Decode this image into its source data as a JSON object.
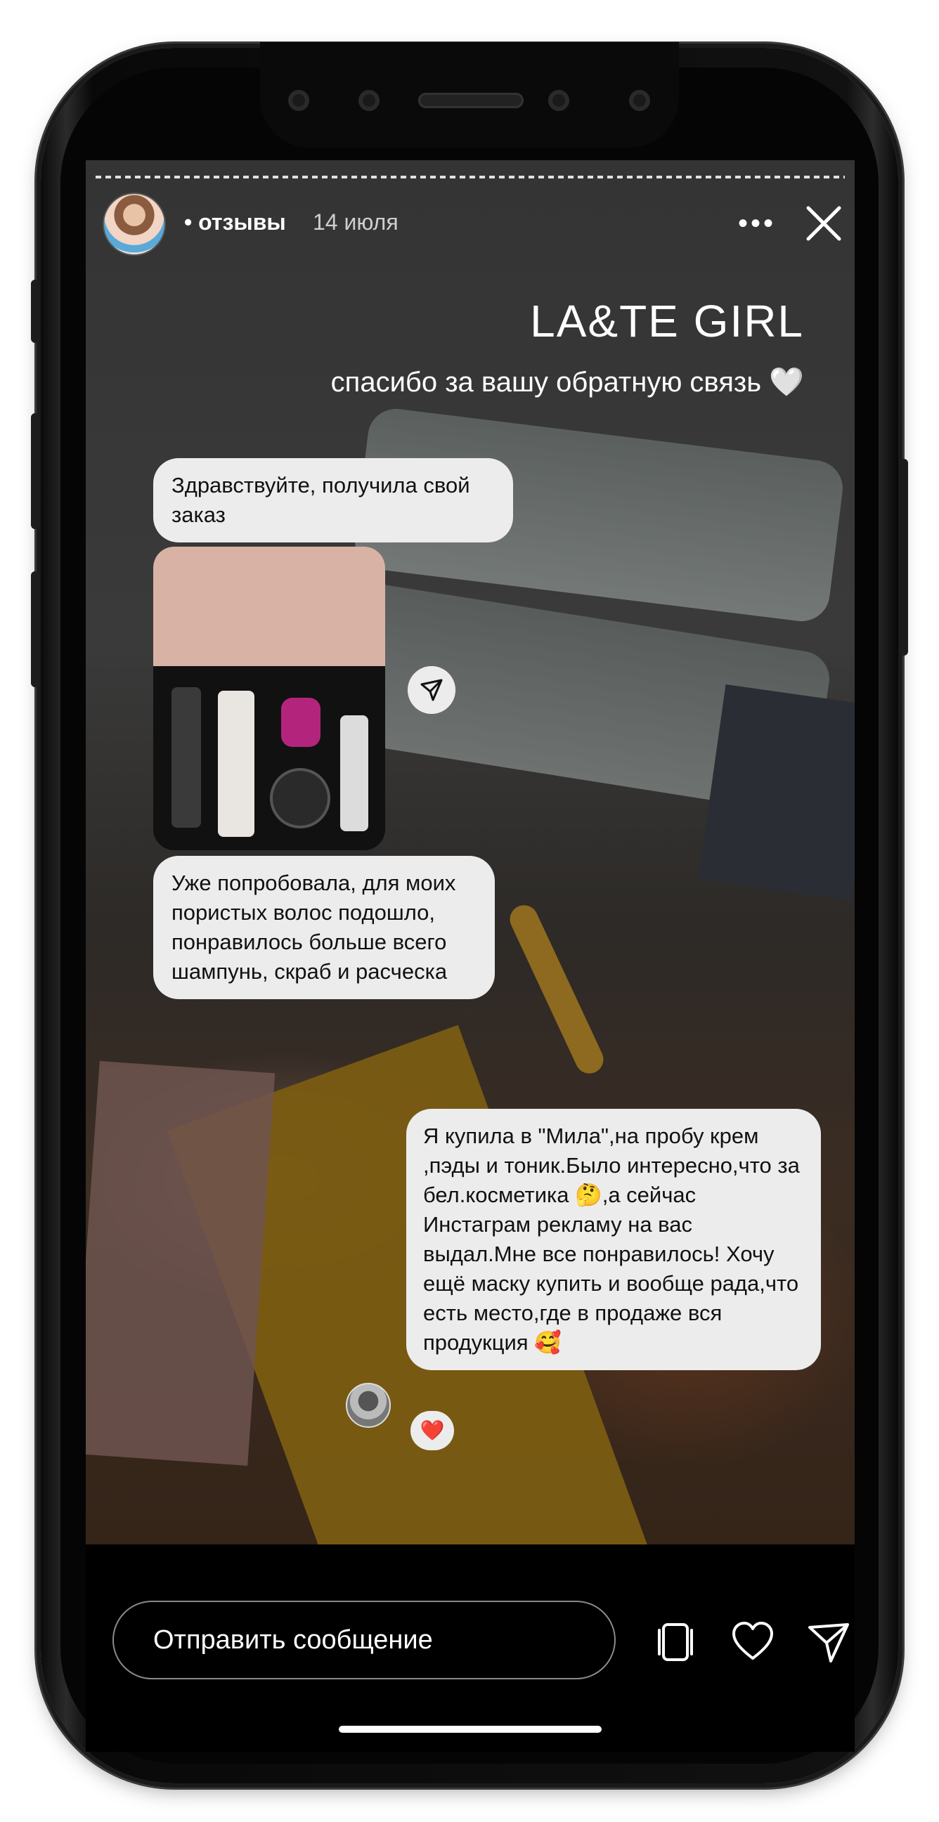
{
  "story": {
    "account": "• отзывы",
    "date": "14 июля",
    "title": "LA&TE GIRL",
    "subtitle": "спасибо за вашу обратную связь 🤍"
  },
  "messages": {
    "first": "Здравствуйте, получила свой заказ",
    "second": "Уже попробовала, для моих пористых волос подошло, понравилось больше всего шампунь, скраб и расческа",
    "third": "Я купила в \"Мила\",на пробу крем ,пэды и тоник.Было интересно,что за бел.косметика 🤔,а сейчас Инстаграм рекламу на вас выдал.Мне все понравилось! Хочу ещё маску купить и вообще рада,что есть место,где в продаже вся продукция 🥰",
    "reaction": "❤️"
  },
  "composer": {
    "placeholder": "Отправить сообщение"
  },
  "icons": [
    "more-icon",
    "close-icon",
    "share-icon",
    "stickers-icon",
    "heart-icon",
    "send-icon"
  ],
  "colors": {
    "bubble": "#ececec",
    "text_dark": "#111111",
    "text_light": "#ffffff"
  }
}
